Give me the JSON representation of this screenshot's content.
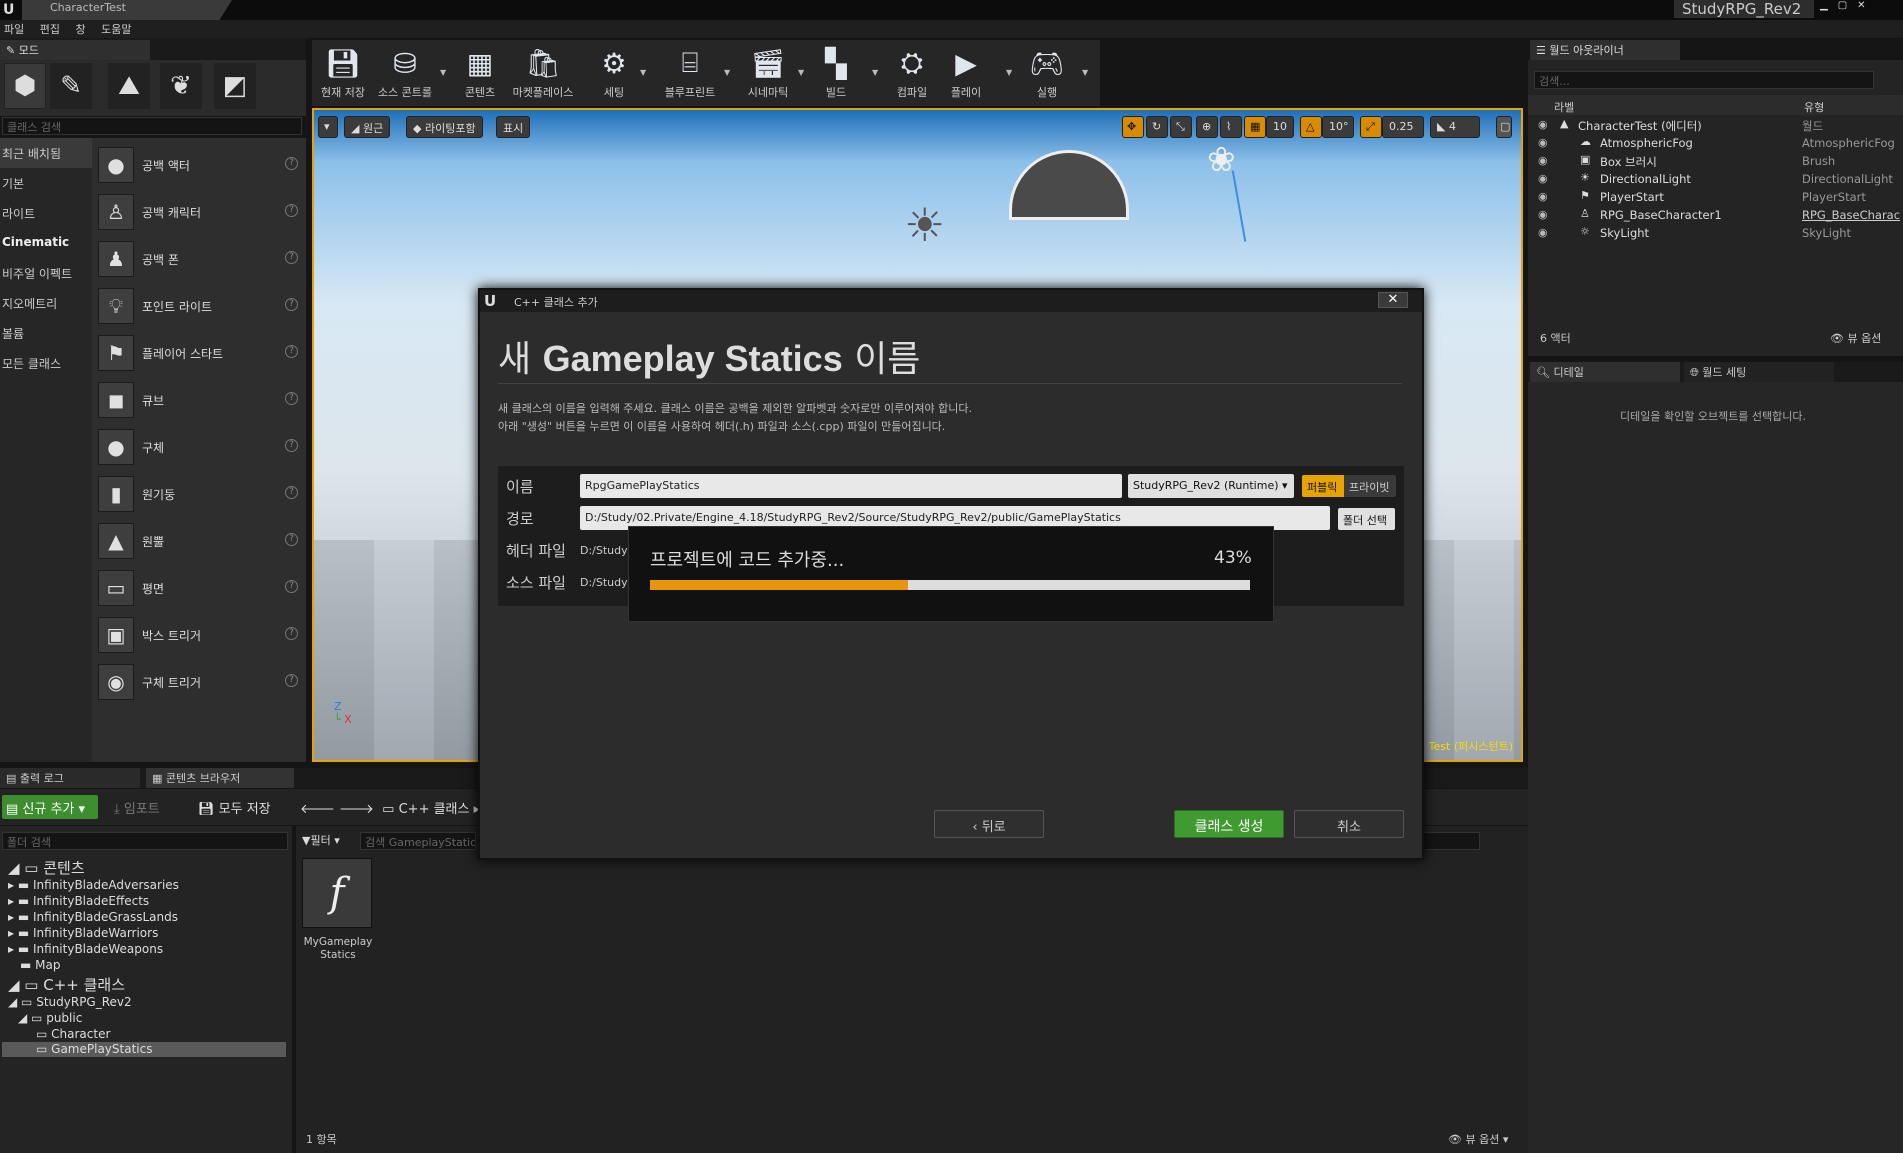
{
  "window": {
    "tab_title": "CharacterTest",
    "project": "StudyRPG_Rev2",
    "logo": "U"
  },
  "menu": [
    "파일",
    "편집",
    "창",
    "도움말"
  ],
  "modes": {
    "tab": "모드",
    "search_placeholder": "클래스 검색",
    "categories": [
      "최근 배치됨",
      "기본",
      "라이트",
      "Cinematic",
      "비주얼 이펙트",
      "지오메트리",
      "볼륨",
      "모든 클래스"
    ],
    "items": [
      {
        "label": "공백 액터",
        "icon": "sphere-icon"
      },
      {
        "label": "공백 캐릭터",
        "icon": "character-icon"
      },
      {
        "label": "공백 폰",
        "icon": "pawn-icon"
      },
      {
        "label": "포인트 라이트",
        "icon": "bulb-icon"
      },
      {
        "label": "플레이어 스타트",
        "icon": "player-start-icon"
      },
      {
        "label": "큐브",
        "icon": "cube-icon"
      },
      {
        "label": "구체",
        "icon": "sphere-icon"
      },
      {
        "label": "원기둥",
        "icon": "cylinder-icon"
      },
      {
        "label": "원뿔",
        "icon": "cone-icon"
      },
      {
        "label": "평면",
        "icon": "plane-icon"
      },
      {
        "label": "박스 트리거",
        "icon": "box-trigger-icon"
      },
      {
        "label": "구체 트리거",
        "icon": "sphere-trigger-icon"
      }
    ]
  },
  "toolbar": {
    "items": [
      {
        "label": "현재 저장",
        "icon": "save-icon"
      },
      {
        "label": "소스 콘트롤",
        "icon": "source-control-icon"
      },
      {
        "label": "콘텐츠",
        "icon": "content-icon"
      },
      {
        "label": "마켓플레이스",
        "icon": "marketplace-icon"
      },
      {
        "label": "세팅",
        "icon": "settings-icon"
      },
      {
        "label": "블루프린트",
        "icon": "blueprint-icon"
      },
      {
        "label": "시네마틱",
        "icon": "cinematic-icon"
      },
      {
        "label": "빌드",
        "icon": "build-icon"
      },
      {
        "label": "컴파일",
        "icon": "compile-icon"
      },
      {
        "label": "플레이",
        "icon": "play-icon"
      },
      {
        "label": "실행",
        "icon": "launch-icon"
      }
    ]
  },
  "viewport": {
    "perspective": "원근",
    "lighting": "라이팅포함",
    "show": "표시",
    "grid_snap": "10",
    "rotation_snap": "10°",
    "scale_snap": "0.25",
    "camera_speed": "4",
    "level_label": "Test (퍼시스턴트)"
  },
  "outliner": {
    "tab": "월드 아웃라이너",
    "search_placeholder": "검색...",
    "col_label": "라벨",
    "col_type": "유형",
    "rows": [
      {
        "label": "CharacterTest (에디터)",
        "type": "월드"
      },
      {
        "label": "AtmosphericFog",
        "type": "AtmosphericFog"
      },
      {
        "label": "Box 브러시",
        "type": "Brush"
      },
      {
        "label": "DirectionalLight",
        "type": "DirectionalLight"
      },
      {
        "label": "PlayerStart",
        "type": "PlayerStart"
      },
      {
        "label": "RPG_BaseCharacter1",
        "type": "RPG_BaseCharac"
      },
      {
        "label": "SkyLight",
        "type": "SkyLight"
      }
    ],
    "actor_count": "6 액터",
    "view_options": "뷰 옵션"
  },
  "details": {
    "tab": "디테일",
    "world_settings_tab": "월드 세팅",
    "hint": "디테일을 확인할 오브젝트를 선택합니다."
  },
  "bottom": {
    "output_log_tab": "출력 로그",
    "content_browser_tab": "콘텐츠 브라우저",
    "add_new": "신규 추가",
    "import": "임포트",
    "save_all": "모두 저장",
    "path": "C++ 클래스",
    "folder_search_placeholder": "폴더 검색",
    "filter": "필터",
    "asset_search_placeholder": "검색 GameplayStatic",
    "tree": [
      {
        "label": "콘텐츠",
        "depth": 0,
        "big": true
      },
      {
        "label": "InfinityBladeAdversaries",
        "depth": 1
      },
      {
        "label": "InfinityBladeEffects",
        "depth": 1
      },
      {
        "label": "InfinityBladeGrassLands",
        "depth": 1
      },
      {
        "label": "InfinityBladeWarriors",
        "depth": 1
      },
      {
        "label": "InfinityBladeWeapons",
        "depth": 1
      },
      {
        "label": "Map",
        "depth": 1
      },
      {
        "label": "C++ 클래스",
        "depth": 0,
        "big": true
      },
      {
        "label": "StudyRPG_Rev2",
        "depth": 1
      },
      {
        "label": "public",
        "depth": 2
      },
      {
        "label": "Character",
        "depth": 3
      },
      {
        "label": "GamePlayStatics",
        "depth": 3,
        "selected": true
      }
    ],
    "asset_name_line1": "MyGameplay",
    "asset_name_line2": "Statics",
    "item_count": "1 항목",
    "view_options": "뷰 옵션"
  },
  "dialog": {
    "title": "C++ 클래스 추가",
    "heading_prefix": "새",
    "heading_class": "Gameplay Statics",
    "heading_suffix": "이름",
    "desc1": "새 클래스의 이름을 입력해 주세요. 클래스 이름은 공백을 제외한 알파벳과 숫자로만 이루어져야 합니다.",
    "desc2": "아래 \"생성\" 버튼을 누르면 이 이름을 사용하여 헤더(.h) 파일과 소스(.cpp) 파일이 만들어집니다.",
    "name_label": "이름",
    "name_value": "RpgGamePlayStatics",
    "module": "StudyRPG_Rev2 (Runtime)",
    "public": "퍼블릭",
    "private": "프라이빗",
    "path_label": "경로",
    "path_value": "D:/Study/02.Private/Engine_4.18/StudyRPG_Rev2/Source/StudyRPG_Rev2/public/GamePlayStatics",
    "choose_folder": "폴더 선택",
    "header_label": "헤더 파일",
    "header_value": "D:/Study",
    "source_label": "소스 파일",
    "source_value": "D:/Study",
    "back": "뒤로",
    "create": "클래스 생성",
    "cancel": "취소"
  },
  "progress": {
    "text": "프로젝트에 코드 추가중...",
    "percent_label": "43%",
    "fraction": 0.43,
    "color": "#e7950b"
  }
}
